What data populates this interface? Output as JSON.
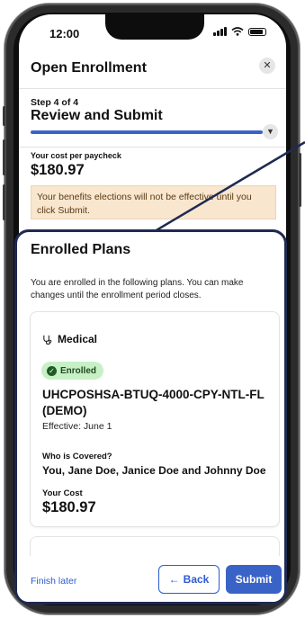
{
  "status_bar": {
    "time": "12:00"
  },
  "header": {
    "title": "Open Enrollment",
    "close_icon": "close-icon"
  },
  "progress": {
    "step_label": "Step 4 of 4",
    "step_title": "Review and Submit",
    "fraction_complete": 1.0
  },
  "summary": {
    "cost_label": "Your cost per paycheck",
    "cost_amount": "$180.97",
    "notice": "Your benefits elections will not be effective until you click Submit."
  },
  "enrolled": {
    "title": "Enrolled Plans",
    "description": "You are enrolled in the following plans. You can make changes until the enrollment period closes.",
    "plans": [
      {
        "category": "Medical",
        "category_icon": "stethoscope-icon",
        "status": "Enrolled",
        "plan_code": "UHCPOSHSA-BTUQ-4000-CPY-NTL-FL (DEMO)",
        "effective": "Effective: June 1",
        "covered_label": "Who is Covered?",
        "covered_names": "You, Jane Doe, Janice Doe and Johnny Doe",
        "cost_label": "Your Cost",
        "cost_amount": "$180.97"
      }
    ]
  },
  "footer": {
    "finish_later": "Finish later",
    "back_label": "Back",
    "submit_label": "Submit"
  },
  "colors": {
    "accent": "#3a63c7",
    "link": "#2c5ad1",
    "highlight_border": "#1f2a52",
    "notice_bg": "#f8e6cf",
    "badge_bg": "#c8f0c6"
  }
}
